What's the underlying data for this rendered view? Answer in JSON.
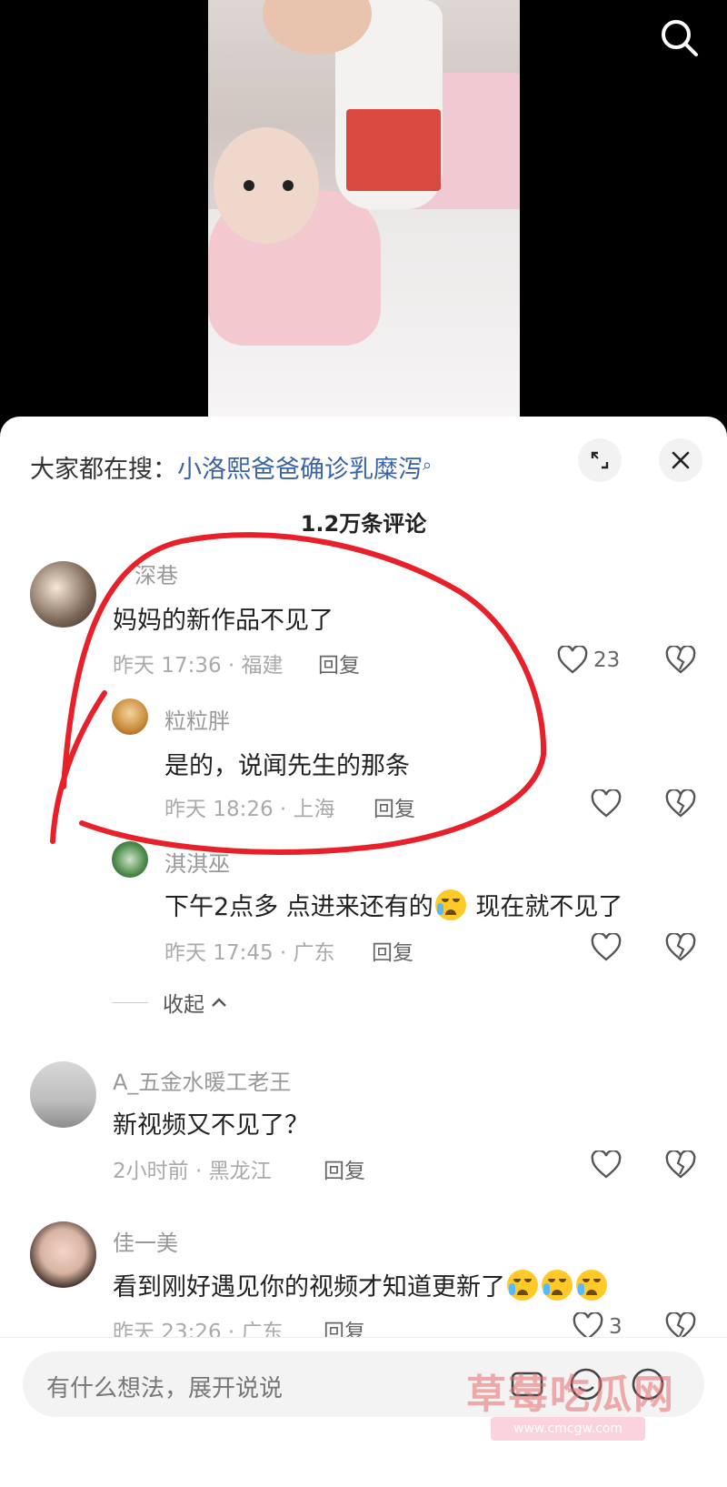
{
  "video": {
    "has_search": true
  },
  "hot_search": {
    "prefix": "大家都在搜：",
    "keyword": "小洛熙爸爸确诊乳糜泻"
  },
  "comment_count": "1.2万条评论",
  "comments": [
    {
      "user": "深巷",
      "text": "妈妈的新作品不见了",
      "meta": "昨天 17:36 · 福建",
      "reply": "回复",
      "likes": "23"
    },
    {
      "user": "粒粒胖",
      "text": "是的，说闻先生的那条",
      "meta": "昨天 18:26 · 上海",
      "reply": "回复",
      "likes": ""
    },
    {
      "user": "淇淇巫",
      "text_a": "下午2点多 点进来还有的",
      "text_b": " 现在就不见了",
      "meta": "昨天 17:45 · 广东",
      "reply": "回复",
      "likes": ""
    },
    {
      "user": "A_五金水暖工老王",
      "text": "新视频又不见了？",
      "meta": "2小时前 · 黑龙江",
      "reply": "回复",
      "likes": ""
    },
    {
      "user": "佳一美",
      "text": "看到刚好遇见你的视频才知道更新了",
      "meta": "昨天 23:26 · 广东",
      "reply": "回复",
      "likes": "3"
    }
  ],
  "collapse_label": "收起",
  "input_placeholder": "有什么想法，展开说说",
  "watermark": {
    "text": "草莓吃瓜网",
    "url": "www.cmcgw.com"
  },
  "colors": {
    "keyword": "#3a63a8",
    "annotation": "#e8202a"
  }
}
